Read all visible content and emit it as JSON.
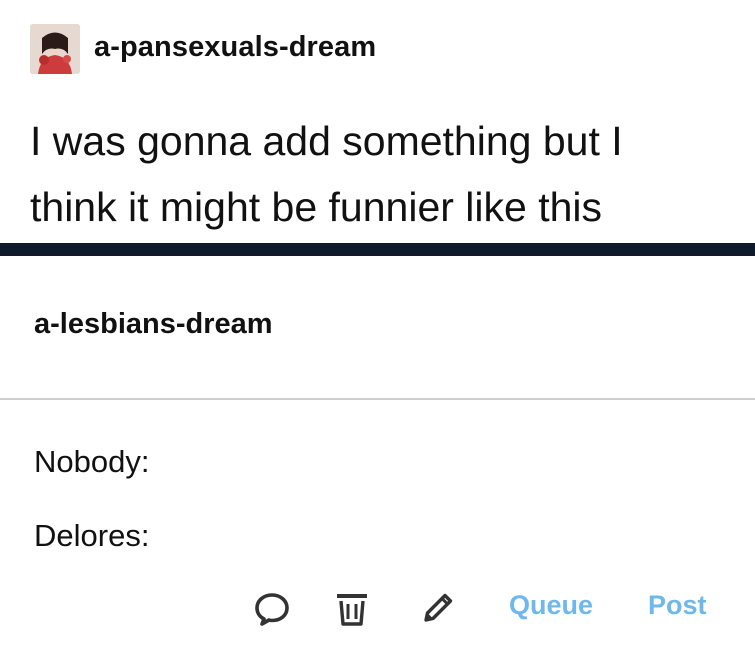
{
  "top_post": {
    "username": "a-pansexuals-dream",
    "avatar_icon": "profile-avatar",
    "body_line_1": "I was gonna add something but I",
    "body_line_2": "think it might be funnier like this"
  },
  "reply_post": {
    "username": "a-lesbians-dream",
    "lines": [
      "Nobody:",
      "Delores:"
    ]
  },
  "footer": {
    "comment_icon": "comment-icon",
    "delete_icon": "trash-icon",
    "edit_icon": "pencil-icon",
    "queue_label": "Queue",
    "post_label": "Post"
  },
  "colors": {
    "divider_dark": "#0f1a2b",
    "accent": "#6fb8eb",
    "text": "#111111"
  }
}
